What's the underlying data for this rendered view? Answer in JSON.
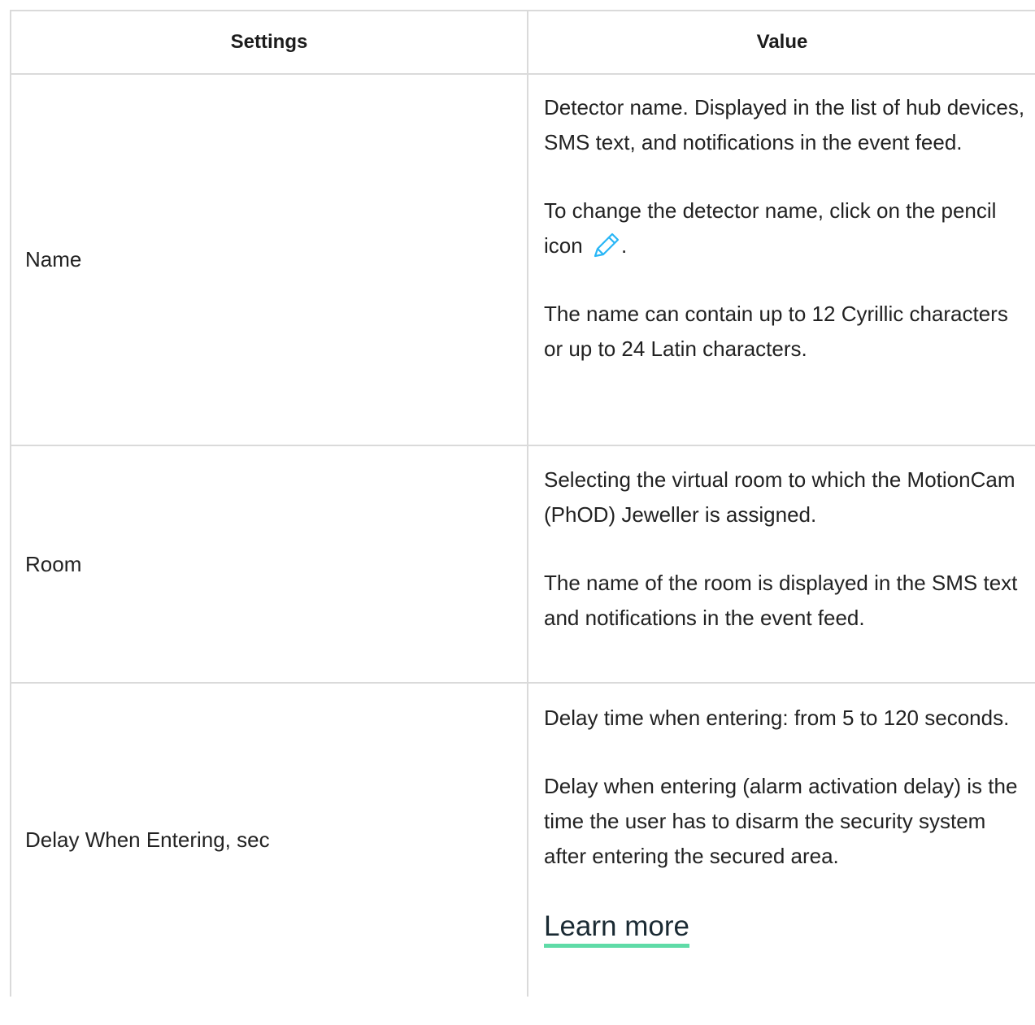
{
  "table": {
    "headers": {
      "settings": "Settings",
      "value": "Value"
    },
    "rows": [
      {
        "name": "Name",
        "paragraphs": [
          "Detector name. Displayed in the list of hub devices, SMS text, and notifications in the event feed.",
          "The name can contain up to 12 Cyrillic characters or up to 24 Latin characters."
        ],
        "pencil_sentence": {
          "before": "To change the detector name, click on the pencil icon",
          "after": ".",
          "icon": "pencil-icon",
          "icon_color": "#29b6f6"
        }
      },
      {
        "name": "Room",
        "paragraphs": [
          "Selecting the virtual room to which the MotionCam (PhOD) Jeweller is assigned.",
          "The name of the room is displayed in the SMS text and notifications in the event feed."
        ]
      },
      {
        "name": "Delay When Entering, sec",
        "paragraphs": [
          "Delay time when entering: from 5 to 120 seconds.",
          "Delay when entering (alarm activation delay) is the time the user has to disarm the security system after entering the secured area."
        ],
        "link": {
          "label": "Learn more",
          "underline_color": "#5fdba7"
        }
      }
    ]
  }
}
